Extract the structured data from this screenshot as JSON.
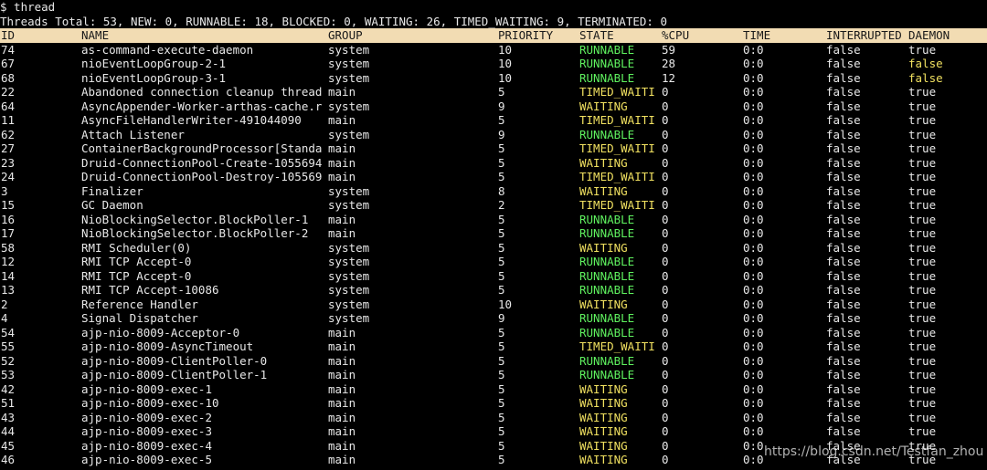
{
  "terminal": {
    "prompt": "$ thread",
    "summary": "Threads Total: 53, NEW: 0, RUNNABLE: 18, BLOCKED: 0, WAITING: 26, TIMED_WAITING: 9, TERMINATED: 0",
    "columns": {
      "id": "ID",
      "name": "NAME",
      "group": "GROUP",
      "priority": "PRIORITY",
      "state": "STATE",
      "cpu": "%CPU",
      "time": "TIME",
      "interrupted": "INTERRUPTED",
      "daemon": "DAEMON"
    },
    "colors": {
      "background": "#000000",
      "text": "#e8e8e8",
      "header_bg": "#f2dcb3",
      "runnable": "#5ff25f",
      "waiting": "#f0e060"
    },
    "rows": [
      [
        "74",
        "as-command-execute-daemon",
        "system",
        "10",
        "RUNNABLE",
        "59",
        "0:0",
        "false",
        "true"
      ],
      [
        "67",
        "nioEventLoopGroup-2-1",
        "system",
        "10",
        "RUNNABLE",
        "28",
        "0:0",
        "false",
        "false"
      ],
      [
        "68",
        "nioEventLoopGroup-3-1",
        "system",
        "10",
        "RUNNABLE",
        "12",
        "0:0",
        "false",
        "false"
      ],
      [
        "22",
        "Abandoned connection cleanup thread",
        "main",
        "5",
        "TIMED_WAITI",
        "0",
        "0:0",
        "false",
        "true"
      ],
      [
        "64",
        "AsyncAppender-Worker-arthas-cache.r",
        "system",
        "9",
        "WAITING",
        "0",
        "0:0",
        "false",
        "true"
      ],
      [
        "11",
        "AsyncFileHandlerWriter-491044090",
        "main",
        "5",
        "TIMED_WAITI",
        "0",
        "0:0",
        "false",
        "true"
      ],
      [
        "62",
        "Attach Listener",
        "system",
        "9",
        "RUNNABLE",
        "0",
        "0:0",
        "false",
        "true"
      ],
      [
        "27",
        "ContainerBackgroundProcessor[Standa",
        "main",
        "5",
        "TIMED_WAITI",
        "0",
        "0:0",
        "false",
        "true"
      ],
      [
        "23",
        "Druid-ConnectionPool-Create-1055694",
        "main",
        "5",
        "WAITING",
        "0",
        "0:0",
        "false",
        "true"
      ],
      [
        "24",
        "Druid-ConnectionPool-Destroy-105569",
        "main",
        "5",
        "TIMED_WAITI",
        "0",
        "0:0",
        "false",
        "true"
      ],
      [
        "3",
        "Finalizer",
        "system",
        "8",
        "WAITING",
        "0",
        "0:0",
        "false",
        "true"
      ],
      [
        "15",
        "GC Daemon",
        "system",
        "2",
        "TIMED_WAITI",
        "0",
        "0:0",
        "false",
        "true"
      ],
      [
        "16",
        "NioBlockingSelector.BlockPoller-1",
        "main",
        "5",
        "RUNNABLE",
        "0",
        "0:0",
        "false",
        "true"
      ],
      [
        "17",
        "NioBlockingSelector.BlockPoller-2",
        "main",
        "5",
        "RUNNABLE",
        "0",
        "0:0",
        "false",
        "true"
      ],
      [
        "58",
        "RMI Scheduler(0)",
        "system",
        "5",
        "WAITING",
        "0",
        "0:0",
        "false",
        "true"
      ],
      [
        "12",
        "RMI TCP Accept-0",
        "system",
        "5",
        "RUNNABLE",
        "0",
        "0:0",
        "false",
        "true"
      ],
      [
        "14",
        "RMI TCP Accept-0",
        "system",
        "5",
        "RUNNABLE",
        "0",
        "0:0",
        "false",
        "true"
      ],
      [
        "13",
        "RMI TCP Accept-10086",
        "system",
        "5",
        "RUNNABLE",
        "0",
        "0:0",
        "false",
        "true"
      ],
      [
        "2",
        "Reference Handler",
        "system",
        "10",
        "WAITING",
        "0",
        "0:0",
        "false",
        "true"
      ],
      [
        "4",
        "Signal Dispatcher",
        "system",
        "9",
        "RUNNABLE",
        "0",
        "0:0",
        "false",
        "true"
      ],
      [
        "54",
        "ajp-nio-8009-Acceptor-0",
        "main",
        "5",
        "RUNNABLE",
        "0",
        "0:0",
        "false",
        "true"
      ],
      [
        "55",
        "ajp-nio-8009-AsyncTimeout",
        "main",
        "5",
        "TIMED_WAITI",
        "0",
        "0:0",
        "false",
        "true"
      ],
      [
        "52",
        "ajp-nio-8009-ClientPoller-0",
        "main",
        "5",
        "RUNNABLE",
        "0",
        "0:0",
        "false",
        "true"
      ],
      [
        "53",
        "ajp-nio-8009-ClientPoller-1",
        "main",
        "5",
        "RUNNABLE",
        "0",
        "0:0",
        "false",
        "true"
      ],
      [
        "42",
        "ajp-nio-8009-exec-1",
        "main",
        "5",
        "WAITING",
        "0",
        "0:0",
        "false",
        "true"
      ],
      [
        "51",
        "ajp-nio-8009-exec-10",
        "main",
        "5",
        "WAITING",
        "0",
        "0:0",
        "false",
        "true"
      ],
      [
        "43",
        "ajp-nio-8009-exec-2",
        "main",
        "5",
        "WAITING",
        "0",
        "0:0",
        "false",
        "true"
      ],
      [
        "44",
        "ajp-nio-8009-exec-3",
        "main",
        "5",
        "WAITING",
        "0",
        "0:0",
        "false",
        "true"
      ],
      [
        "45",
        "ajp-nio-8009-exec-4",
        "main",
        "5",
        "WAITING",
        "0",
        "0:0",
        "false",
        "true"
      ],
      [
        "46",
        "ajp-nio-8009-exec-5",
        "main",
        "5",
        "WAITING",
        "0",
        "0:0",
        "false",
        "true"
      ]
    ]
  },
  "watermark": "https://blog.csdn.net/Testfan_zhou"
}
